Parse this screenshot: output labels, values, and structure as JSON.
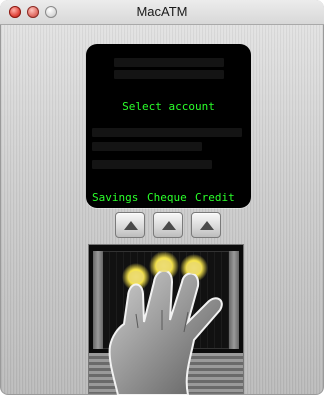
{
  "window": {
    "title": "MacATM"
  },
  "screen": {
    "message": "Select account",
    "options": [
      "Savings",
      "Cheque",
      "Credit"
    ]
  },
  "colors": {
    "screen_text": "#2aff2a",
    "screen_bg": "#000000"
  },
  "icons": {
    "close": "close-icon",
    "minimize": "minimize-icon",
    "zoom": "zoom-icon",
    "select": "up-triangle-icon",
    "fingerprint": "hand-icon"
  }
}
